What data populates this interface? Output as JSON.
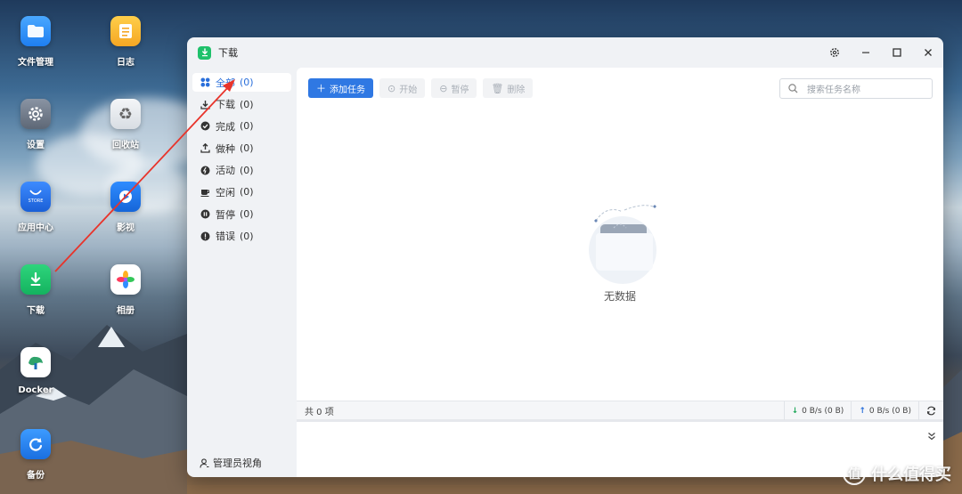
{
  "desktop": {
    "icons": [
      {
        "label": "文件管理",
        "icon": "folder-icon"
      },
      {
        "label": "日志",
        "icon": "notes-icon"
      },
      {
        "label": "设置",
        "icon": "gear-icon"
      },
      {
        "label": "回收站",
        "icon": "recycle-icon"
      },
      {
        "label": "应用中心",
        "icon": "store-icon",
        "badge": "STORE"
      },
      {
        "label": "影视",
        "icon": "video-icon"
      },
      {
        "label": "下载",
        "icon": "download-icon"
      },
      {
        "label": "相册",
        "icon": "photos-icon"
      },
      {
        "label": "Docker",
        "icon": "docker-icon"
      },
      {
        "label": "备份",
        "icon": "backup-icon"
      }
    ]
  },
  "window": {
    "title": "下载",
    "controls": [
      "settings-icon",
      "minimize-icon",
      "maximize-icon",
      "close-icon"
    ]
  },
  "sidebar": {
    "items": [
      {
        "label": "全部",
        "count": "(0)",
        "icon": "grid-icon",
        "active": true
      },
      {
        "label": "下载",
        "count": "(0)",
        "icon": "download-icon"
      },
      {
        "label": "完成",
        "count": "(0)",
        "icon": "check-icon"
      },
      {
        "label": "做种",
        "count": "(0)",
        "icon": "upload-icon"
      },
      {
        "label": "活动",
        "count": "(0)",
        "icon": "activity-icon"
      },
      {
        "label": "空闲",
        "count": "(0)",
        "icon": "cup-icon"
      },
      {
        "label": "暂停",
        "count": "(0)",
        "icon": "pause-icon"
      },
      {
        "label": "错误",
        "count": "(0)",
        "icon": "error-icon"
      }
    ],
    "admin_label": "管理员视角"
  },
  "toolbar": {
    "add_label": "添加任务",
    "start_label": "开始",
    "pause_label": "暂停",
    "delete_label": "删除",
    "search_placeholder": "搜索任务名称"
  },
  "main": {
    "empty_text": "无数据"
  },
  "statusbar": {
    "total": "共 0 项",
    "down_rate": "0 B/s (0 B)",
    "up_rate": "0 B/s (0 B)"
  },
  "colors": {
    "accent": "#2f78e3",
    "download_green": "#1fc16b"
  },
  "watermark": {
    "text": "什么值得买",
    "icon_char": "值"
  }
}
